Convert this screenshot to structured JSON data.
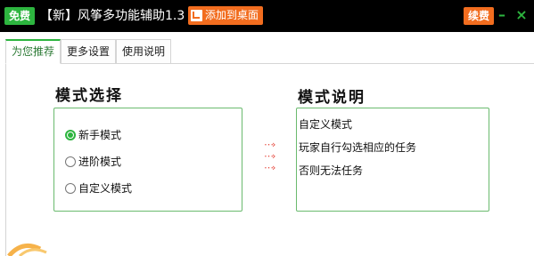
{
  "titlebar": {
    "badge": "免费",
    "title": "【新】风筝多功能辅助1.3",
    "add_desktop": "添加到桌面",
    "renew": "续费",
    "minimize": "–",
    "close": "×"
  },
  "tabs": [
    {
      "label": "为您推荐",
      "active": true
    },
    {
      "label": "更多设置",
      "active": false
    },
    {
      "label": "使用说明",
      "active": false
    }
  ],
  "mode_select": {
    "heading": "模式选择",
    "options": [
      {
        "label": "新手模式",
        "checked": true
      },
      {
        "label": "进阶模式",
        "checked": false
      },
      {
        "label": "自定义模式",
        "checked": false
      }
    ]
  },
  "mode_desc": {
    "heading": "模式说明",
    "lines": [
      "自定义模式",
      "玩家自行勾选相应的任务",
      "否则无法任务"
    ]
  },
  "arrows": [
    "⋯›",
    "⋯›",
    "⋯›"
  ],
  "colors": {
    "green": "#2db53f",
    "orange": "#f26d1f",
    "arrow_red": "#e5453a",
    "box_border": "#6aba6e"
  }
}
